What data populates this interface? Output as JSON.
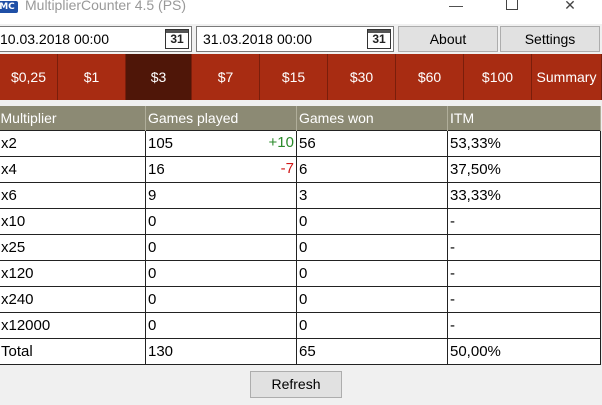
{
  "window": {
    "title": "MultiplierCounter 4.5 (PS)",
    "icon_label": "MC",
    "min_glyph": "—",
    "close_glyph": "✕"
  },
  "toolbar": {
    "date_from": "10.03.2018 00:00",
    "date_to": "31.03.2018 00:00",
    "calendar_label": "31",
    "about_label": "About",
    "settings_label": "Settings"
  },
  "tabs": [
    "$0,25",
    "$1",
    "$3",
    "$7",
    "$15",
    "$30",
    "$60",
    "$100",
    "Summary"
  ],
  "active_tab": "$3",
  "table": {
    "headers": [
      "Multiplier",
      "Games played",
      "Games won",
      "ITM"
    ],
    "rows": [
      {
        "multiplier": "x2",
        "played": "105",
        "delta": "+10",
        "delta_type": "pos",
        "won": "56",
        "itm": "53,33%"
      },
      {
        "multiplier": "x4",
        "played": "16",
        "delta": "-7",
        "delta_type": "neg",
        "won": "6",
        "itm": "37,50%"
      },
      {
        "multiplier": "x6",
        "played": "9",
        "delta": "",
        "delta_type": "",
        "won": "3",
        "itm": "33,33%"
      },
      {
        "multiplier": "x10",
        "played": "0",
        "delta": "",
        "delta_type": "",
        "won": "0",
        "itm": "-"
      },
      {
        "multiplier": "x25",
        "played": "0",
        "delta": "",
        "delta_type": "",
        "won": "0",
        "itm": "-"
      },
      {
        "multiplier": "x120",
        "played": "0",
        "delta": "",
        "delta_type": "",
        "won": "0",
        "itm": "-"
      },
      {
        "multiplier": "x240",
        "played": "0",
        "delta": "",
        "delta_type": "",
        "won": "0",
        "itm": "-"
      },
      {
        "multiplier": "x12000",
        "played": "0",
        "delta": "",
        "delta_type": "",
        "won": "0",
        "itm": "-"
      },
      {
        "multiplier": "Total",
        "played": "130",
        "delta": "",
        "delta_type": "",
        "won": "65",
        "itm": "50,00%"
      }
    ]
  },
  "refresh_label": "Refresh",
  "colors": {
    "tab_bar": "#a82c12",
    "tab_active": "#4f1608",
    "header_bg": "#8c8a74",
    "delta_positive": "#2a8a2a",
    "delta_negative": "#d01818"
  }
}
